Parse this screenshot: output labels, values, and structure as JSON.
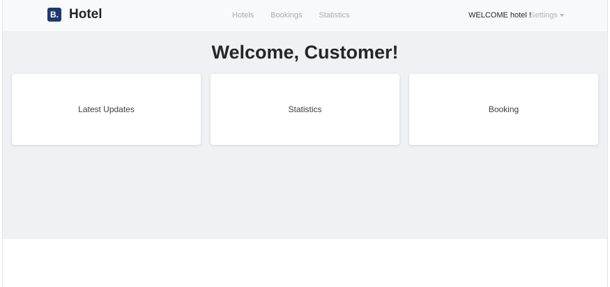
{
  "navbar": {
    "brand_logo": "B.",
    "brand_name": "Hotel",
    "links": [
      "Hotels",
      "Bookings",
      "Statistics"
    ],
    "welcome_text": "WELCOME hotel !",
    "settings_label": "Settings"
  },
  "main": {
    "title": "Welcome, Customer!",
    "cards": [
      "Latest Updates",
      "Statistics",
      "Booking"
    ]
  },
  "colors": {
    "brand": "#1d3a6b",
    "navbar_bg": "#f8f9fa",
    "content_bg": "#f0f1f4"
  },
  "icons": {
    "brand": "booking-b-logo-icon",
    "settings": "caret-down-icon"
  }
}
